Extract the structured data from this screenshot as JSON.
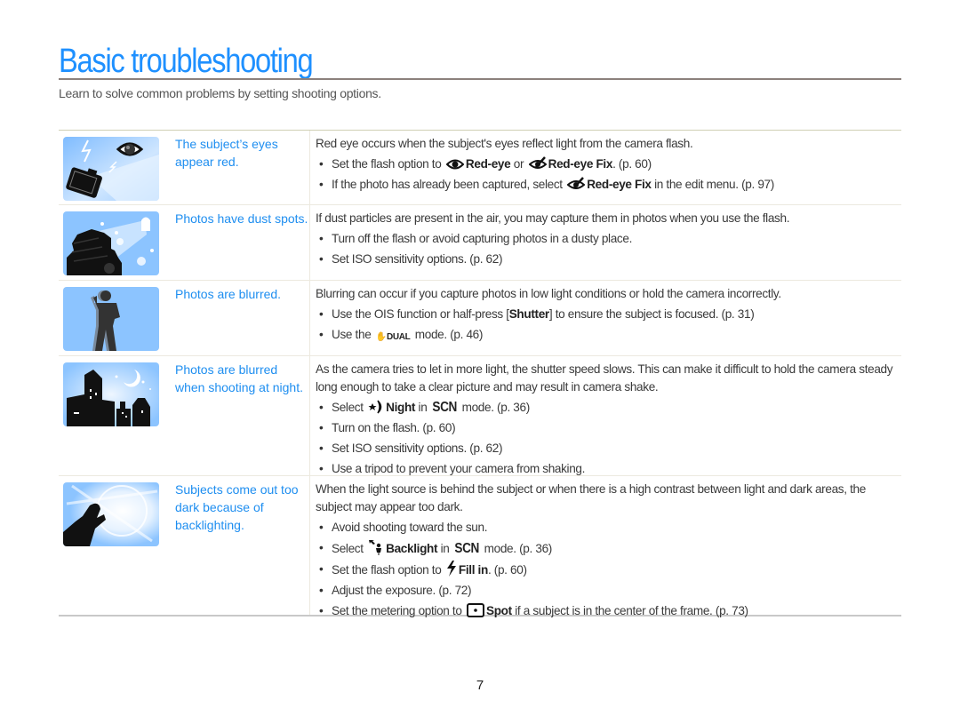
{
  "page": {
    "title": "Basic troubleshooting",
    "subtitle": "Learn to solve common problems by setting shooting options.",
    "page_number": "7"
  },
  "colors": {
    "accent": "#1e8ef0",
    "title_rule": "#8c817c",
    "thumb_bg": "#8cc4ff"
  },
  "rows": [
    {
      "image_icon": "red-eye-camera-illustration",
      "issue": "The subject’s eyes appear red.",
      "intro": "Red eye occurs when the subject's eyes reflect light from the camera flash.",
      "bullets": [
        {
          "pre": "Set the flash option to",
          "icon1": "red-eye-icon",
          "bold1": "Red-eye",
          "mid": "or",
          "icon2": "red-eye-fix-icon",
          "bold2": "Red-eye Fix",
          "post": ". (p. 60)"
        },
        {
          "pre": "If the photo has already been captured, select",
          "icon1": "red-eye-fix-icon",
          "bold1": "Red-eye Fix",
          "post": "in the edit menu. (p. 97)"
        }
      ]
    },
    {
      "image_icon": "dust-spots-camera-illustration",
      "issue": "Photos have dust spots.",
      "intro": "If dust particles are present in the air, you may capture them in photos when you use the flash.",
      "bullets": [
        {
          "text": "Turn off the flash or avoid capturing photos in a dusty place."
        },
        {
          "text": "Set ISO sensitivity options. (p. 62)"
        }
      ]
    },
    {
      "image_icon": "blurred-person-illustration",
      "issue": "Photos are blurred.",
      "intro": "Blurring can occur if you capture photos in low light conditions or hold the camera incorrectly.",
      "bullets": [
        {
          "pre": "Use the OIS function or half-press [",
          "bold1": "Shutter",
          "post": "] to ensure the subject is focused. (p. 31)"
        },
        {
          "pre": "Use the",
          "icon1": "dual-is-icon",
          "icon1_text": "DUAL",
          "post": "mode. (p. 46)"
        }
      ]
    },
    {
      "image_icon": "night-city-illustration",
      "issue": "Photos are blurred when shooting at night.",
      "intro": "As the camera tries to let in more light, the shutter speed slows. This can make it difficult to hold the camera steady long enough to take a clear picture and may result in camera shake.",
      "bullets": [
        {
          "pre": "Select",
          "icon1": "night-icon",
          "bold1": "Night",
          "mid": "in",
          "scn": "SCN",
          "post": "mode. (p. 36)"
        },
        {
          "text": "Turn on the flash. (p. 60)"
        },
        {
          "text": "Set ISO sensitivity options. (p. 62)"
        },
        {
          "text": "Use a tripod to prevent your camera from shaking."
        }
      ]
    },
    {
      "image_icon": "backlight-person-illustration",
      "issue": "Subjects come out too dark because of backlighting.",
      "intro": "When the light source is behind the subject or when there is a high contrast between light and dark areas, the subject may appear too dark.",
      "bullets": [
        {
          "text": "Avoid shooting toward the sun."
        },
        {
          "pre": "Select",
          "icon1": "backlight-icon",
          "bold1": "Backlight",
          "mid": "in",
          "scn": "SCN",
          "post": "mode. (p. 36)"
        },
        {
          "pre": "Set the flash option to",
          "icon1": "fill-in-flash-icon",
          "bold1": "Fill in",
          "post": ". (p. 60)"
        },
        {
          "text": "Adjust the exposure. (p. 72)"
        },
        {
          "pre": "Set the metering option to",
          "icon1": "spot-metering-icon",
          "bold1": "Spot",
          "post": "if a subject is in the center of the frame. (p. 73)"
        }
      ]
    }
  ]
}
